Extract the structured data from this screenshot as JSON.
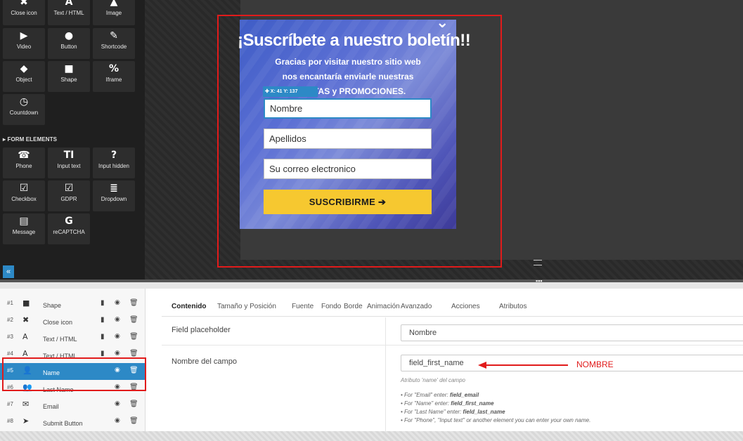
{
  "sidebar": {
    "tiles": [
      {
        "label": "Close icon",
        "icon": "✖"
      },
      {
        "label": "Text / HTML",
        "icon": "A"
      },
      {
        "label": "Image",
        "icon": "▲"
      },
      {
        "label": "Video",
        "icon": "▶"
      },
      {
        "label": "Button",
        "icon": "●"
      },
      {
        "label": "Shortcode",
        "icon": "✎"
      },
      {
        "label": "Object",
        "icon": "◆"
      },
      {
        "label": "Shape",
        "icon": "■"
      },
      {
        "label": "Iframe",
        "icon": "%"
      },
      {
        "label": "Countdown",
        "icon": "◷"
      }
    ],
    "form_section": "FORM ELEMENTS",
    "form_tiles": [
      {
        "label": "Phone",
        "icon": "☎"
      },
      {
        "label": "Input text",
        "icon": "TI"
      },
      {
        "label": "Input hidden",
        "icon": "?"
      },
      {
        "label": "Checkbox",
        "icon": "☑"
      },
      {
        "label": "GDPR",
        "icon": "☑"
      },
      {
        "label": "Dropdown",
        "icon": "≣"
      },
      {
        "label": "Message",
        "icon": "▤"
      },
      {
        "label": "reCAPTCHA",
        "icon": "G"
      }
    ],
    "collapse_icon": "«"
  },
  "popup": {
    "close_icon": "⌄",
    "title": "¡Suscríbete a nuestro boletín!!",
    "text": "Gracias por visitar nuestro sitio web nos encantaría enviarle nuestras OFERTAS y PROMOCIONES.",
    "coord_tag": "✚ X: 41  Y: 137",
    "inputs": [
      "Nombre",
      "Apellidos",
      "Su correo electronico"
    ],
    "button": "SUSCRIBIRME ➔",
    "accent": "#2d89c6",
    "button_color": "#f6c830"
  },
  "layers": [
    {
      "num": "#1",
      "icon": "■",
      "name": "Shape",
      "copy": "▮",
      "eye": "◉",
      "del": "🗑",
      "selected": false
    },
    {
      "num": "#2",
      "icon": "✖",
      "name": "Close icon",
      "copy": "▮",
      "eye": "◉",
      "del": "🗑",
      "selected": false
    },
    {
      "num": "#3",
      "icon": "A",
      "name": "Text / HTML",
      "copy": "▮",
      "eye": "◉",
      "del": "🗑",
      "selected": false
    },
    {
      "num": "#4",
      "icon": "A",
      "name": "Text / HTML",
      "copy": "▮",
      "eye": "◉",
      "del": "🗑",
      "selected": false
    },
    {
      "num": "#5",
      "icon": "👤",
      "name": "Name",
      "copy": "",
      "eye": "◉",
      "del": "🗑",
      "selected": true
    },
    {
      "num": "#6",
      "icon": "👥",
      "name": "Last Name",
      "copy": "",
      "eye": "◉",
      "del": "🗑",
      "selected": false
    },
    {
      "num": "#7",
      "icon": "✉",
      "name": "Email",
      "copy": "",
      "eye": "◉",
      "del": "🗑",
      "selected": false
    },
    {
      "num": "#8",
      "icon": "➤",
      "name": "Submit Button",
      "copy": "",
      "eye": "◉",
      "del": "🗑",
      "selected": false
    }
  ],
  "props": {
    "tabs": [
      "Contenido",
      "Tamaño y Posición",
      "Fuente",
      "Fondo",
      "Borde",
      "Animación",
      "Avanzado",
      "Acciones",
      "Atributos"
    ],
    "active_tab": "Contenido",
    "placeholder_label": "Field placeholder",
    "placeholder_value": "Nombre",
    "name_label": "Nombre del campo",
    "name_value": "field_first_name",
    "help_title": "Atributo 'name' del campo",
    "help_items": [
      {
        "prefix": "For \"Email\" enter: ",
        "key": "field_email"
      },
      {
        "prefix": "For \"Name\" enter: ",
        "key": "field_first_name"
      },
      {
        "prefix": "For \"Last Name\" enter: ",
        "key": "field_last_name"
      },
      {
        "prefix": "For \"Phone\", \"Input text\" or another element you can enter your own name.",
        "key": ""
      }
    ]
  },
  "annotation": {
    "text": "NOMBRE",
    "color": "#e11b1b"
  }
}
